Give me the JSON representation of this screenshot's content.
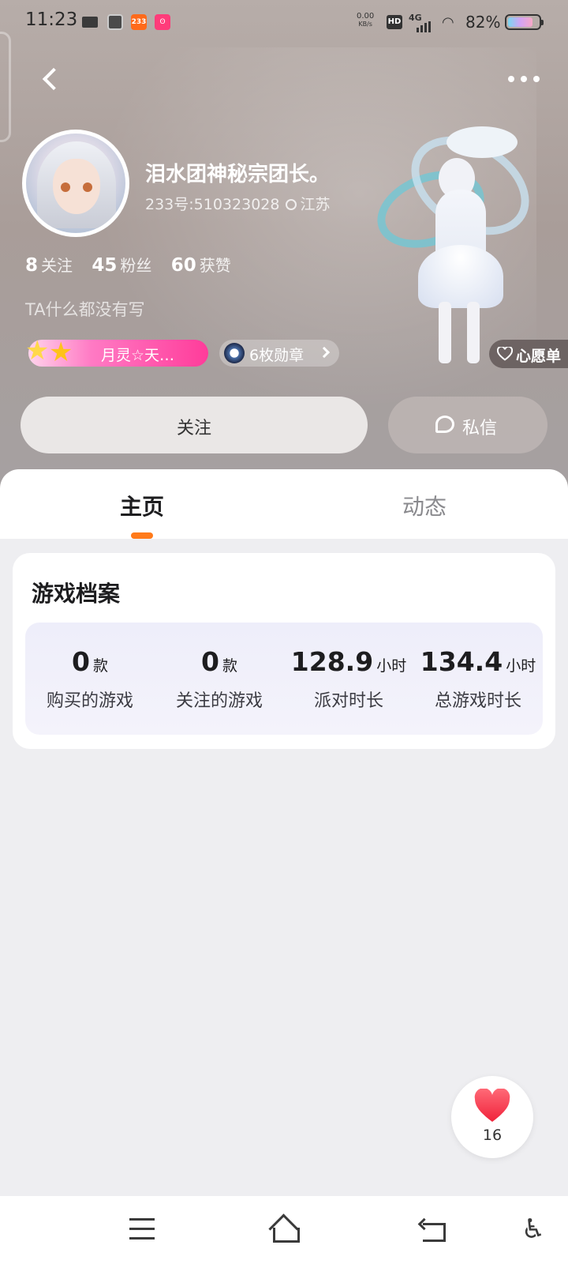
{
  "status_bar": {
    "time": "11:23",
    "app_badge_1": "233",
    "net_speed_value": "0.00",
    "net_speed_unit": "KB/s",
    "hd": "HD",
    "network": "4G",
    "battery": "82%"
  },
  "profile": {
    "nickname": "泪水团神秘宗团长。",
    "uid": "233号:510323028",
    "location": "江苏",
    "stats": [
      {
        "value": "8",
        "label": "关注"
      },
      {
        "value": "45",
        "label": "粉丝"
      },
      {
        "value": "60",
        "label": "获赞"
      }
    ],
    "bio": "TA什么都没有写",
    "title_badge": "月灵☆天…",
    "medals": "6枚勋章"
  },
  "wishlist_label": "心愿单",
  "actions": {
    "follow": "关注",
    "message": "私信"
  },
  "tabs": [
    {
      "label": "主页",
      "active": true
    },
    {
      "label": "动态",
      "active": false
    }
  ],
  "game_profile": {
    "title": "游戏档案",
    "stats": [
      {
        "value": "0",
        "unit": "款",
        "label": "购买的游戏"
      },
      {
        "value": "0",
        "unit": "款",
        "label": "关注的游戏"
      },
      {
        "value": "128.9",
        "unit": "小时",
        "label": "派对时长"
      },
      {
        "value": "134.4",
        "unit": "小时",
        "label": "总游戏时长"
      }
    ]
  },
  "like_button": {
    "count": "16"
  },
  "colors": {
    "accent": "#ff7a1a",
    "title_badge": "#ff3c9a",
    "heart": "#ff3b4e"
  }
}
